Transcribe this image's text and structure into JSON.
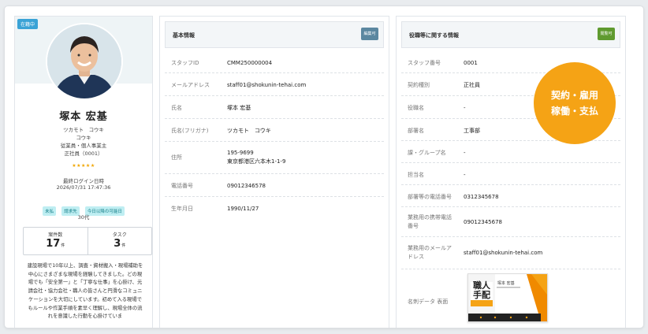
{
  "profile": {
    "status_badge": "在籍中",
    "name": "塚本 宏基",
    "kana_line1": "ツカモト　コウキ",
    "kana_line2": "コウキ",
    "role_line": "従業員・個人事業主",
    "type_line": "正社員（0001）",
    "stars": "★★★★★",
    "last_login_label": "最終ログイン日時",
    "last_login_value": "2026/07/31 17:47:36",
    "tags": [
      "未払",
      "請求先",
      "今日以降の可能日"
    ],
    "age": "30代",
    "stats": [
      {
        "label": "案件数",
        "value": "17",
        "unit": "件"
      },
      {
        "label": "タスク",
        "value": "3",
        "unit": "件"
      }
    ],
    "bio": "建設現場で10年以上、調査・資材搬入・現場補助を中心にさまざまな現場を経験してきました。どの現場でも「安全第一」と「丁寧な仕事」を心掛け、元請会社・協力会社・職人の皆さんと円滑なコミュニケーションを大切にしています。初めて入る現場でもルールや作業手順を素早く理解し、現場全体の流れを意識した行動を心掛けていま"
  },
  "basic": {
    "title": "基本情報",
    "edit_label": "編集可",
    "edit_color": "#5b87a0",
    "rows": [
      {
        "label": "スタッフID",
        "value": "CMM250000004"
      },
      {
        "label": "メールアドレス",
        "value": "staff01@shokunin-tehai.com"
      },
      {
        "label": "氏名",
        "value": "塚本 宏基"
      },
      {
        "label": "氏名(フリガナ)",
        "value": "ツカモト　コウキ"
      },
      {
        "label": "住所",
        "value": "195-9699",
        "value2": "東京都港区六本木1-1-9"
      },
      {
        "label": "電話番号",
        "value": "09012346578"
      },
      {
        "label": "生年月日",
        "value": "1990/11/27"
      }
    ]
  },
  "roles": {
    "title": "役職等に関する情報",
    "edit_label": "閲覧可",
    "edit_color": "#5f9a2f",
    "circle_line1": "契約・雇用",
    "circle_line2": "稼働・支払",
    "circle_color": "#f5a315",
    "rows": [
      {
        "label": "スタッフ番号",
        "value": "0001"
      },
      {
        "label": "契約種別",
        "value": "正社員"
      },
      {
        "label": "役職名",
        "value": "-"
      },
      {
        "label": "部署名",
        "value": "工事部"
      },
      {
        "label": "課・グループ名",
        "value": "-"
      },
      {
        "label": "担当名",
        "value": "-"
      },
      {
        "label": "部署等の電話番号",
        "value": "0312345678"
      },
      {
        "label": "業務用の携帯電話",
        "label2": "番号",
        "value": "09012345678"
      },
      {
        "label": "業務用のメールア",
        "label2": "ドレス",
        "value": "staff01@shokunin-tehai.com"
      },
      {
        "label": "名刺データ 表面",
        "value": ""
      }
    ],
    "business_card": {
      "logo_top": "職人",
      "logo_bottom": "手配",
      "person": "塚本 宏基"
    }
  }
}
